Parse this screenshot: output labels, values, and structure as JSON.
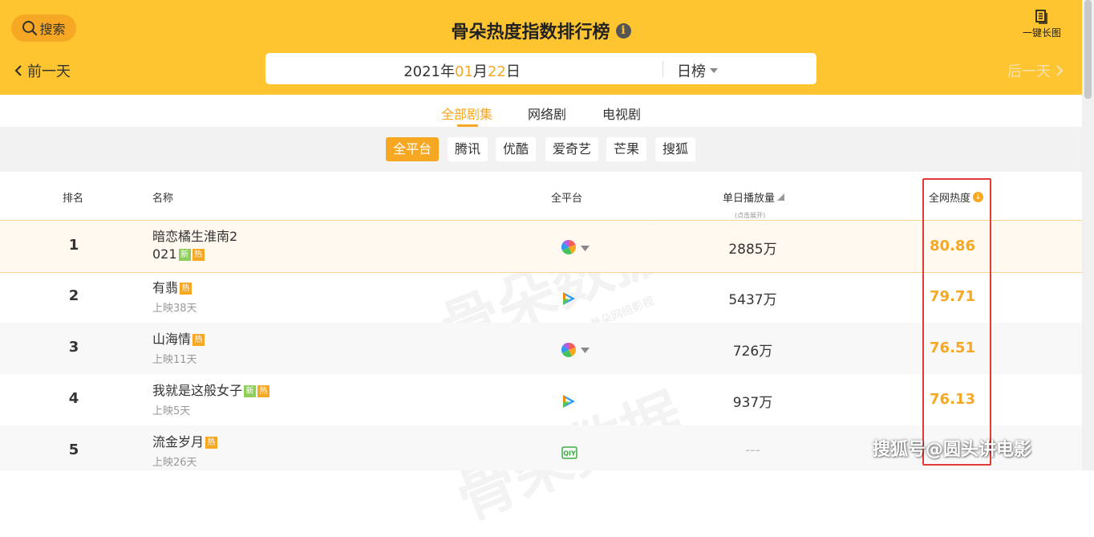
{
  "header": {
    "search_label": "搜索",
    "title": "骨朵热度指数排行榜",
    "info_icon": "i",
    "long_image_label": "一键长图",
    "prev_day": "前一天",
    "next_day": "后一天",
    "date": {
      "year": "2021",
      "year_unit": "年",
      "month": "01",
      "month_unit": "月",
      "day": "22",
      "day_unit": "日"
    },
    "rank_type": "日榜"
  },
  "tabs": [
    {
      "label": "全部剧集",
      "active": true
    },
    {
      "label": "网络剧",
      "active": false
    },
    {
      "label": "电视剧",
      "active": false
    }
  ],
  "platforms": [
    {
      "label": "全平台",
      "active": true
    },
    {
      "label": "腾讯",
      "active": false
    },
    {
      "label": "优酷",
      "active": false
    },
    {
      "label": "爱奇艺",
      "active": false
    },
    {
      "label": "芒果",
      "active": false
    },
    {
      "label": "搜狐",
      "active": false
    }
  ],
  "table": {
    "headers": {
      "rank": "排名",
      "name": "名称",
      "platform": "全平台",
      "daily_plays": "单日播放量",
      "daily_plays_note": "(点击展开)",
      "heat": "全网热度",
      "heat_sort_icon": "↓"
    },
    "rows": [
      {
        "rank": "1",
        "name_line1": "暗恋橘生淮南2",
        "name_line2": "021",
        "tags": [
          "新",
          "热"
        ],
        "sub": "",
        "platform": "multi",
        "plays": "2885万",
        "heat": "80.86"
      },
      {
        "rank": "2",
        "name_line1": "有翡",
        "name_line2": "",
        "tags": [
          "热"
        ],
        "sub": "上映38天",
        "platform": "tencent",
        "plays": "5437万",
        "heat": "79.71"
      },
      {
        "rank": "3",
        "name_line1": "山海情",
        "name_line2": "",
        "tags": [
          "热"
        ],
        "sub": "上映11天",
        "platform": "multi",
        "plays": "726万",
        "heat": "76.51"
      },
      {
        "rank": "4",
        "name_line1": "我就是这般女子",
        "name_line2": "",
        "tags": [
          "新",
          "热"
        ],
        "sub": "上映5天",
        "platform": "tencent",
        "plays": "937万",
        "heat": "76.13"
      },
      {
        "rank": "5",
        "name_line1": "流金岁月",
        "name_line2": "",
        "tags": [
          "热"
        ],
        "sub": "上映26天",
        "platform": "iqiyi",
        "plays": "---",
        "heat": ""
      }
    ]
  },
  "watermark": {
    "text": "骨朵数据",
    "sub": "@骨朵网络影视"
  },
  "sohu_watermark": "搜狐号@圆头讲电影",
  "colors": {
    "header_bg": "#ffc530",
    "accent": "#f7a823",
    "highlight_box": "#e53935"
  }
}
